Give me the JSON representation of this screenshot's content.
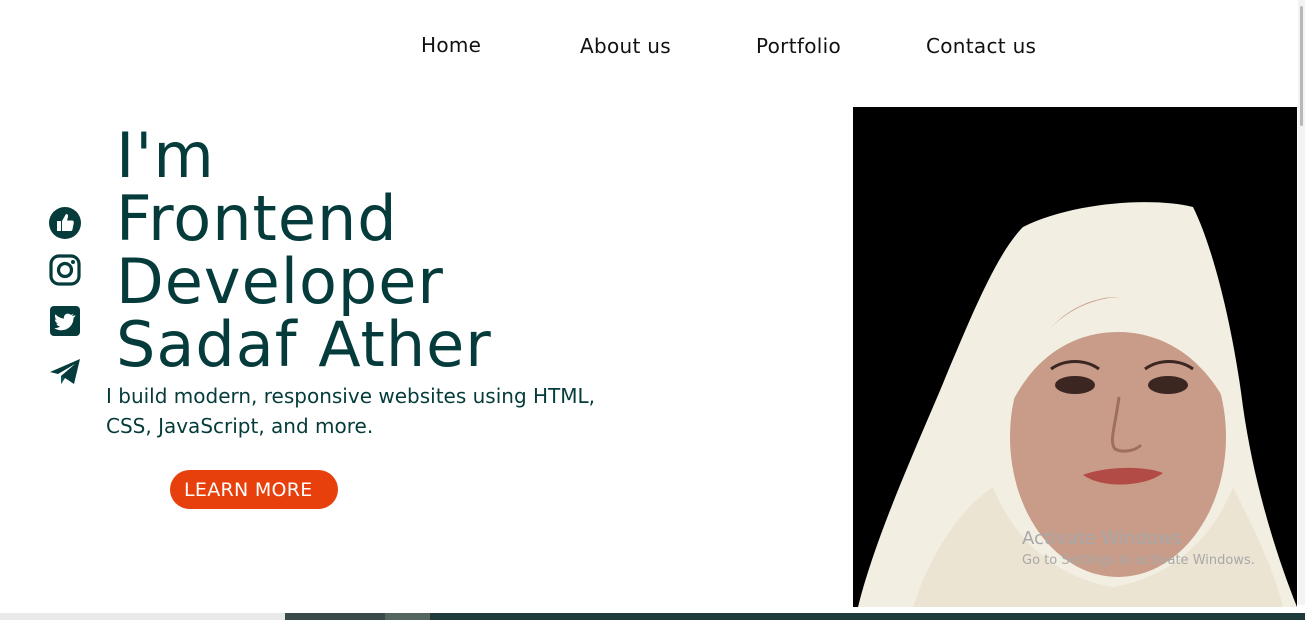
{
  "nav": {
    "home": "Home",
    "about": "About us",
    "portfolio": "Portfolio",
    "contact": "Contact us"
  },
  "socials": [
    "thumbs-up-icon",
    "instagram-icon",
    "twitter-icon",
    "telegram-icon"
  ],
  "hero": {
    "line1": "I'm",
    "line2": "Frontend",
    "line3": "Developer",
    "line4": "Sadaf Ather",
    "subtitle": "I build modern, responsive websites using HTML, CSS, JavaScript, and more.",
    "cta": "LEARN MORE"
  },
  "watermark": {
    "title": "Activate Windows",
    "subtitle": "Go to Settings to activate Windows."
  },
  "colors": {
    "heading": "#053b3b",
    "cta_bg": "#e8400c",
    "photo_bg": "#000000"
  }
}
